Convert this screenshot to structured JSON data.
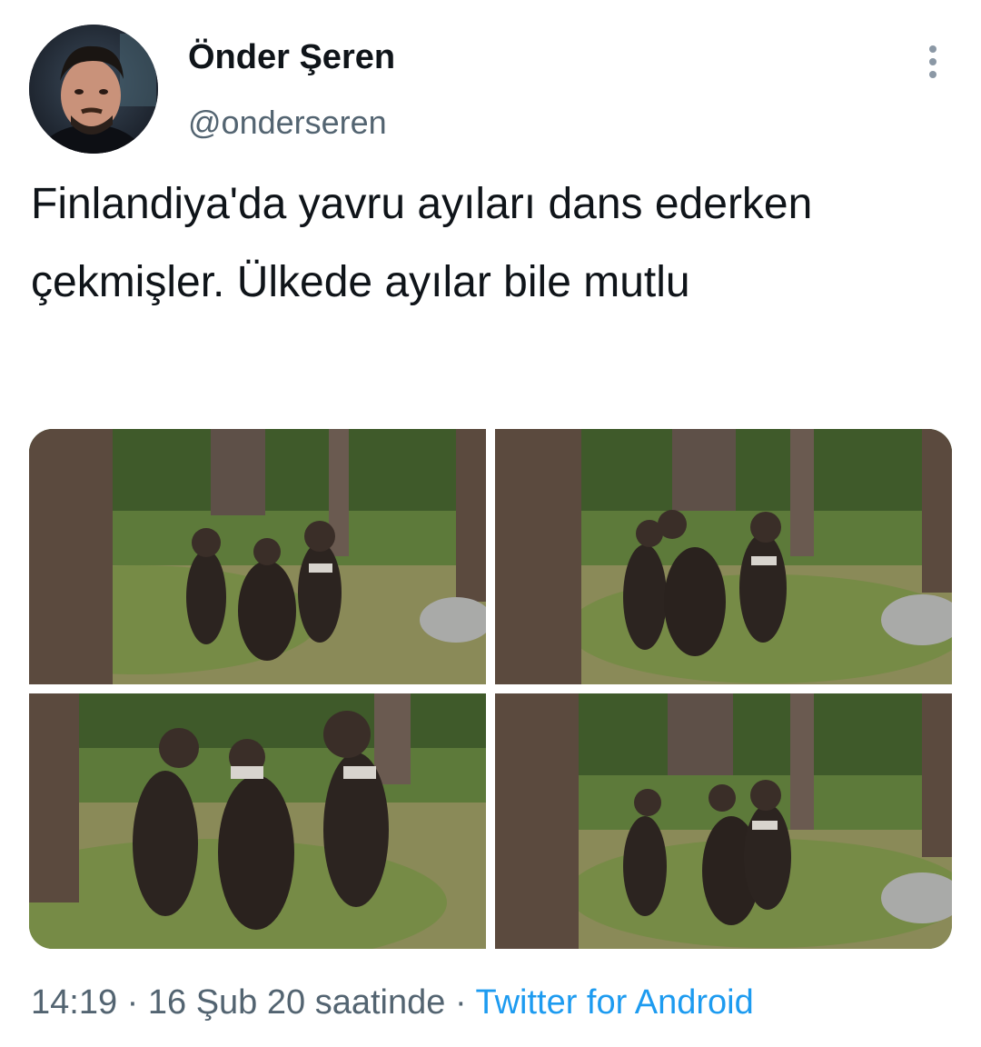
{
  "tweet": {
    "author": {
      "display_name": "Önder Şeren",
      "handle": "@onderseren",
      "avatar_icon": "user-avatar-photo"
    },
    "more_icon": "vertical-ellipsis-icon",
    "text": "Finlandiya'da yavru ayıları dans ederken çekmişler. Ülkede ayılar bile mutlu",
    "media": [
      {
        "name": "bear-cubs-photo-1"
      },
      {
        "name": "bear-cubs-photo-2"
      },
      {
        "name": "bear-cubs-photo-3"
      },
      {
        "name": "bear-cubs-photo-4"
      }
    ],
    "time": "14:19",
    "separator": "·",
    "date": "16 Şub 20 saatinde",
    "source": "Twitter for Android"
  },
  "colors": {
    "text_primary": "#0f1419",
    "text_secondary": "#536471",
    "link": "#1d9bf0",
    "background": "#ffffff"
  }
}
